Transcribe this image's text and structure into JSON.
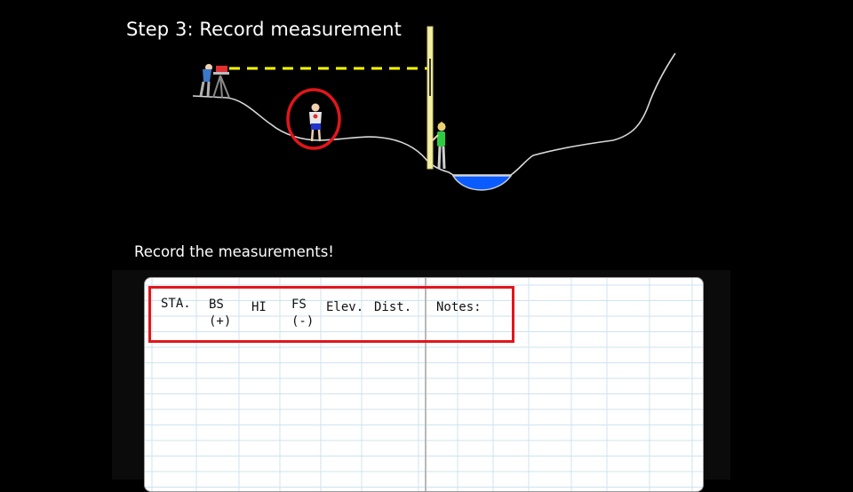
{
  "slide": {
    "title": "Step 3: Record measurement",
    "subtitle": "Record the measurements!"
  },
  "colors": {
    "background": "#000000",
    "terrain_line": "#d9d9d9",
    "sight_line": "#ffff00",
    "highlight": "#e0161b",
    "water": "#0b5cff",
    "rod": "#f3f0a0",
    "grid_line": "#cfe3ef"
  },
  "illustration": {
    "icons": [
      "level-instrument-icon",
      "surveyor-icon",
      "rodman-icon",
      "person-circled-icon",
      "water-channel-icon",
      "leveling-rod-icon"
    ]
  },
  "notebook": {
    "columns": [
      {
        "label": "STA."
      },
      {
        "label": "BS\n(+)"
      },
      {
        "label": "HI"
      },
      {
        "label": "FS\n(-)"
      },
      {
        "label": "Elev."
      },
      {
        "label": "Dist."
      },
      {
        "label": "Notes:"
      }
    ]
  }
}
